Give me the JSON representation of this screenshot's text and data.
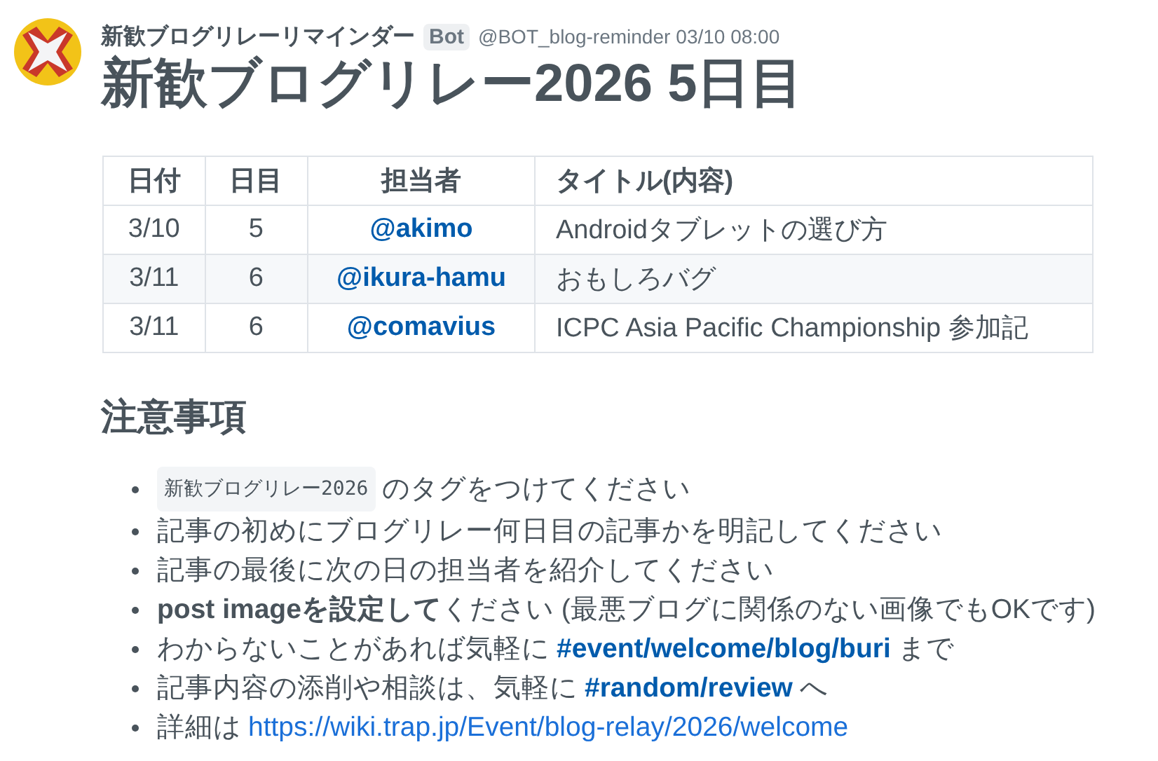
{
  "author": {
    "name": "新歓ブログリレーリマインダー",
    "badge": "Bot",
    "handle": "@BOT_blog-reminder",
    "time": "03/10 08:00"
  },
  "title": "新歓ブログリレー2026 5日目",
  "table": {
    "columns": [
      "日付",
      "日目",
      "担当者",
      "タイトル(内容)"
    ],
    "rows": [
      {
        "date": "3/10",
        "day": "5",
        "user": "@akimo",
        "topic": "Androidタブレットの選び方"
      },
      {
        "date": "3/11",
        "day": "6",
        "user": "@ikura-hamu",
        "topic": "おもしろバグ"
      },
      {
        "date": "3/11",
        "day": "6",
        "user": "@comavius",
        "topic": "ICPC Asia Pacific Championship 参加記"
      }
    ]
  },
  "notes_heading": "注意事項",
  "notes": [
    [
      {
        "kind": "tag",
        "text": "新歓ブログリレー2026"
      },
      {
        "kind": "text",
        "text": "のタグをつけてください"
      }
    ],
    [
      {
        "kind": "text",
        "text": "記事の初めにブログリレー何日目の記事かを明記してください"
      }
    ],
    [
      {
        "kind": "text",
        "text": "記事の最後に次の日の担当者を紹介してください"
      }
    ],
    [
      {
        "kind": "text",
        "text": "**post imageを設定して**ください (最悪ブログに関係のない画像でもOKです)"
      }
    ],
    [
      {
        "kind": "text",
        "text": "わからないことがあれば気軽に"
      },
      {
        "kind": "channel",
        "text": "#event/welcome/blog/buri"
      },
      {
        "kind": "text",
        "text": "まで"
      }
    ],
    [
      {
        "kind": "text",
        "text": "記事内容の添削や相談は、気軽に"
      },
      {
        "kind": "channel",
        "text": "#random/review"
      },
      {
        "kind": "text",
        "text": "へ"
      }
    ],
    [
      {
        "kind": "text",
        "text": "詳細は"
      },
      {
        "kind": "link",
        "text": "https://wiki.trap.jp/Event/blog-relay/2026/welcome"
      }
    ]
  ]
}
